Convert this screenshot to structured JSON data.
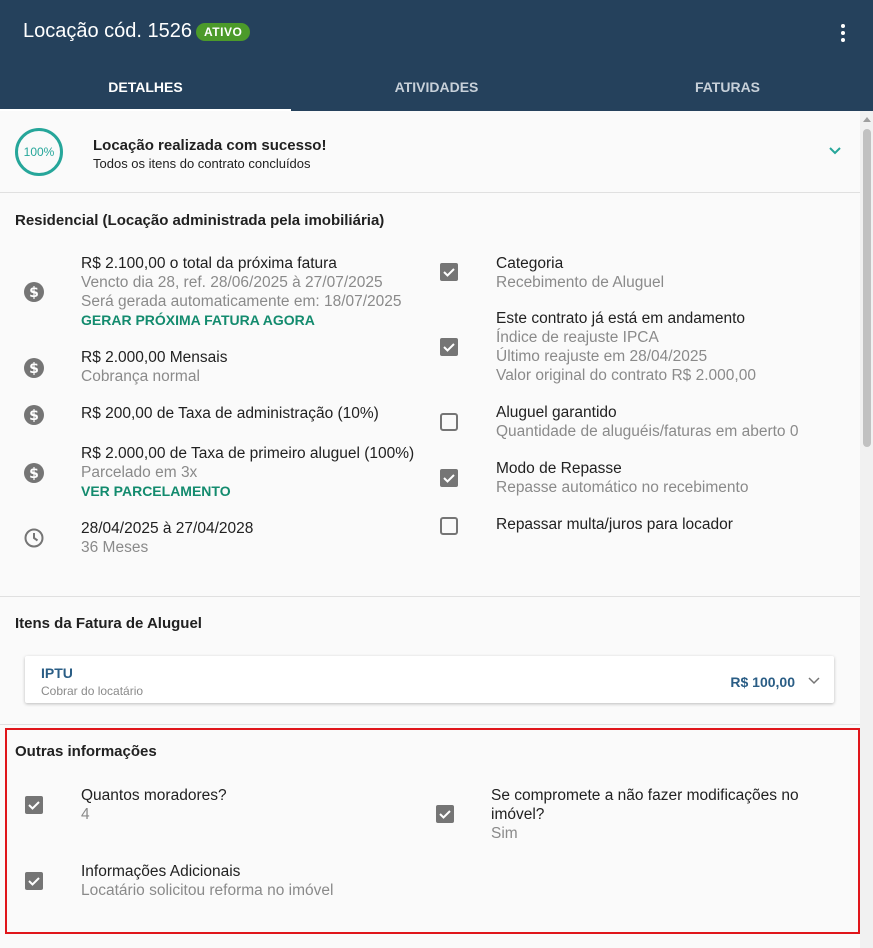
{
  "header": {
    "title": "Locação cód. 1526",
    "badge": "ATIVO",
    "tabs": [
      {
        "label": "DETALHES",
        "active": true
      },
      {
        "label": "ATIVIDADES",
        "active": false
      },
      {
        "label": "FATURAS",
        "active": false
      }
    ]
  },
  "success": {
    "progress": "100%",
    "title": "Locação realizada com sucesso!",
    "subtitle": "Todos os itens do contrato concluídos"
  },
  "residencial": {
    "title": "Residencial (Locação administrada pela imobiliária)",
    "left": [
      {
        "icon": "dollar-icon",
        "lines": [
          "R$ 2.100,00 o total da próxima fatura",
          "Vencto dia 28, ref. 28/06/2025 à 27/07/2025",
          "Será gerada automaticamente em: 18/07/2025"
        ],
        "link": "GERAR PRÓXIMA FATURA AGORA"
      },
      {
        "icon": "dollar-icon",
        "lines": [
          "R$ 2.000,00 Mensais",
          "Cobrança normal"
        ]
      },
      {
        "icon": "dollar-icon",
        "lines": [
          "R$ 200,00 de Taxa de administração (10%)"
        ]
      },
      {
        "icon": "dollar-icon",
        "lines": [
          "R$ 2.000,00 de Taxa de primeiro aluguel (100%)",
          "Parcelado em 3x"
        ],
        "link": "VER PARCELAMENTO"
      },
      {
        "icon": "clock-icon",
        "lines": [
          "28/04/2025 à 27/04/2028",
          "36 Meses"
        ]
      }
    ],
    "right": [
      {
        "checked": true,
        "lines": [
          "Categoria",
          "Recebimento de Aluguel"
        ]
      },
      {
        "checked": true,
        "lines": [
          "Este contrato já está em andamento",
          "Índice de reajuste IPCA",
          "Último reajuste em 28/04/2025",
          "Valor original do contrato R$ 2.000,00"
        ]
      },
      {
        "checked": false,
        "lines": [
          "Aluguel garantido",
          "Quantidade de aluguéis/faturas em aberto 0"
        ]
      },
      {
        "checked": true,
        "lines": [
          "Modo de Repasse",
          "Repasse automático no recebimento"
        ]
      },
      {
        "checked": false,
        "lines": [
          "Repassar multa/juros para locador"
        ]
      }
    ]
  },
  "itens_fatura": {
    "title": "Itens da Fatura de Aluguel",
    "items": [
      {
        "name": "IPTU",
        "desc": "Cobrar do locatário",
        "value": "R$ 100,00"
      }
    ]
  },
  "outras": {
    "title": "Outras informações",
    "items": [
      {
        "checked": true,
        "lines": [
          "Quantos moradores?",
          "4"
        ]
      },
      {
        "checked": true,
        "lines": [
          "Se compromete a não fazer modificações no",
          "imóvel?",
          "Sim"
        ]
      },
      {
        "checked": true,
        "lines": [
          "Informações Adicionais",
          "Locatário solicitou reforma no imóvel"
        ]
      }
    ]
  },
  "colors": {
    "appbar": "#25415c",
    "badge": "#4c9a2a",
    "accent": "#26a69a",
    "link": "#138b6e",
    "card_text": "#2a5d85",
    "highlight": "#e0161b"
  }
}
